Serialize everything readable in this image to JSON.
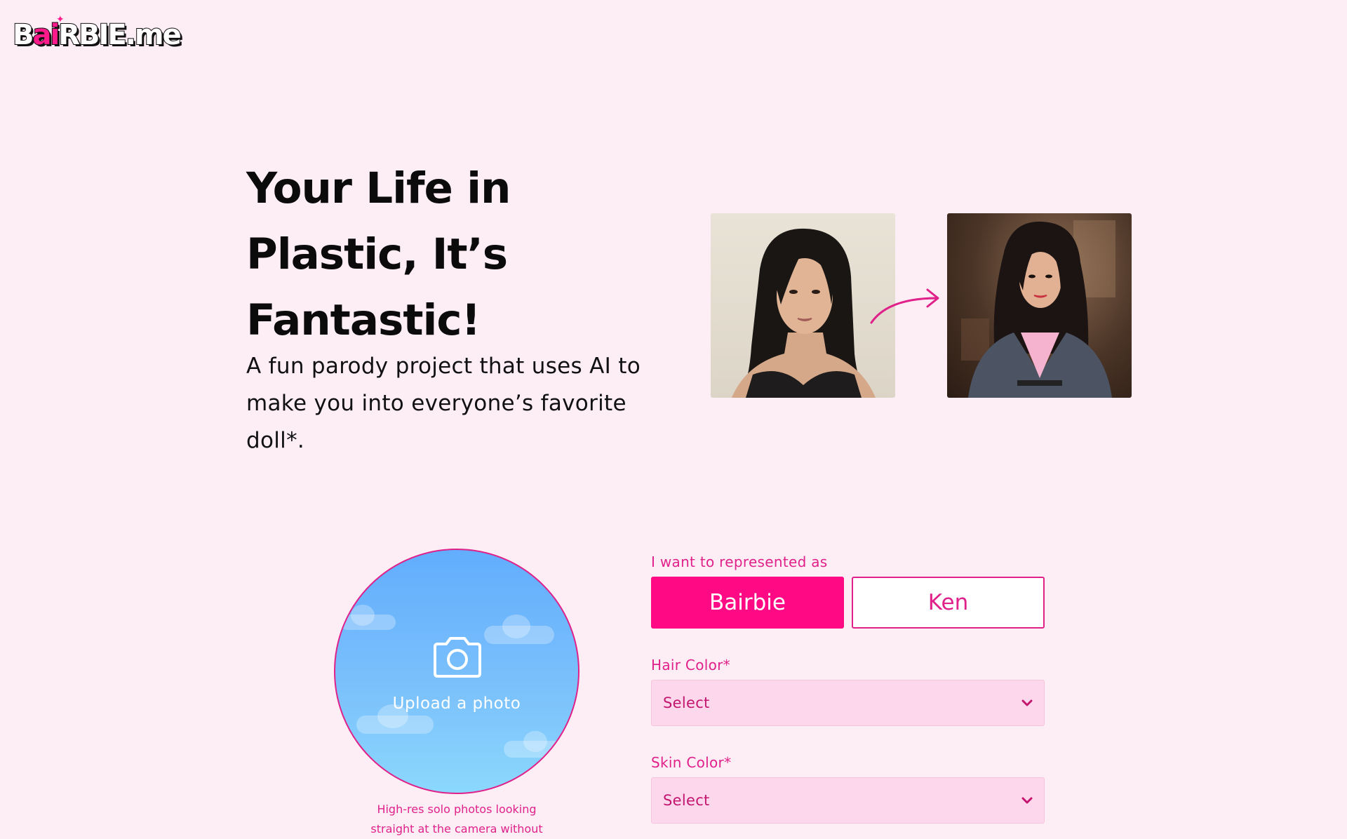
{
  "logo": {
    "prefix": "B",
    "pink": "ai",
    "suffix": "RBIE.me"
  },
  "hero": {
    "title": "Your Life in Plastic, It’s Fantastic!",
    "subtitle": "A fun parody project that uses AI to make you into everyone’s favorite doll*."
  },
  "upload": {
    "label": "Upload a photo",
    "hint": "High-res solo photos looking straight at the camera without"
  },
  "form": {
    "represent_label": "I want to represented as",
    "options": [
      "Bairbie",
      "Ken"
    ],
    "selected_option": "Bairbie",
    "hair": {
      "label": "Hair Color*",
      "value": "Select"
    },
    "skin": {
      "label": "Skin Color*",
      "value": "Select"
    }
  },
  "colors": {
    "background": "#fdedf5",
    "accent": "#ff0a84",
    "text_pink": "#e0218a",
    "select_bg": "#fdd8ec"
  }
}
